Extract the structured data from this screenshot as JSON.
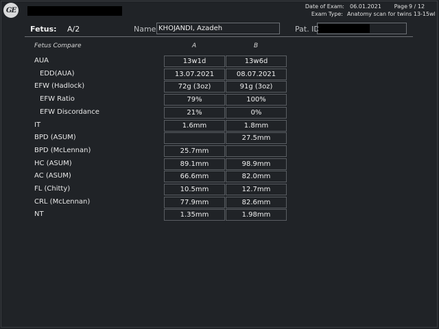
{
  "header": {
    "logo_text": "GE",
    "date_label": "Date of Exam:",
    "date_value": "06.01.2021",
    "page_label": "Page",
    "page_value": "9 / 12",
    "exam_type_label": "Exam Type:",
    "exam_type_value": "Anatomy scan for twins 13-15wk"
  },
  "patient": {
    "fetus_label": "Fetus:",
    "fetus_value": "A/2",
    "name_label": "Name",
    "name_value": "KHOJANDI, Azadeh",
    "pat_id_label": "Pat. ID"
  },
  "table": {
    "title": "Fetus Compare",
    "col_a": "A",
    "col_b": "B",
    "rows": [
      {
        "label": "AUA",
        "a": "13w1d",
        "b": "13w6d",
        "indent": false
      },
      {
        "label": "EDD(AUA)",
        "a": "13.07.2021",
        "b": "08.07.2021",
        "indent": true
      },
      {
        "label": "EFW (Hadlock)",
        "a": "72g (3oz)",
        "b": "91g (3oz)",
        "indent": false
      },
      {
        "label": "EFW Ratio",
        "a": "79%",
        "b": "100%",
        "indent": true
      },
      {
        "label": "EFW Discordance",
        "a": "21%",
        "b": "0%",
        "indent": true
      },
      {
        "label": "IT",
        "a": "1.6mm",
        "b": "1.8mm",
        "indent": false
      },
      {
        "label": "BPD (ASUM)",
        "a": "",
        "b": "27.5mm",
        "indent": false
      },
      {
        "label": "BPD (McLennan)",
        "a": "25.7mm",
        "b": "",
        "indent": false
      },
      {
        "label": "HC (ASUM)",
        "a": "89.1mm",
        "b": "98.9mm",
        "indent": false
      },
      {
        "label": "AC (ASUM)",
        "a": "66.6mm",
        "b": "82.0mm",
        "indent": false
      },
      {
        "label": "FL (Chitty)",
        "a": "10.5mm",
        "b": "12.7mm",
        "indent": false
      },
      {
        "label": "CRL (McLennan)",
        "a": "77.9mm",
        "b": "82.6mm",
        "indent": false
      },
      {
        "label": "NT",
        "a": "1.35mm",
        "b": "1.98mm",
        "indent": false
      }
    ]
  }
}
